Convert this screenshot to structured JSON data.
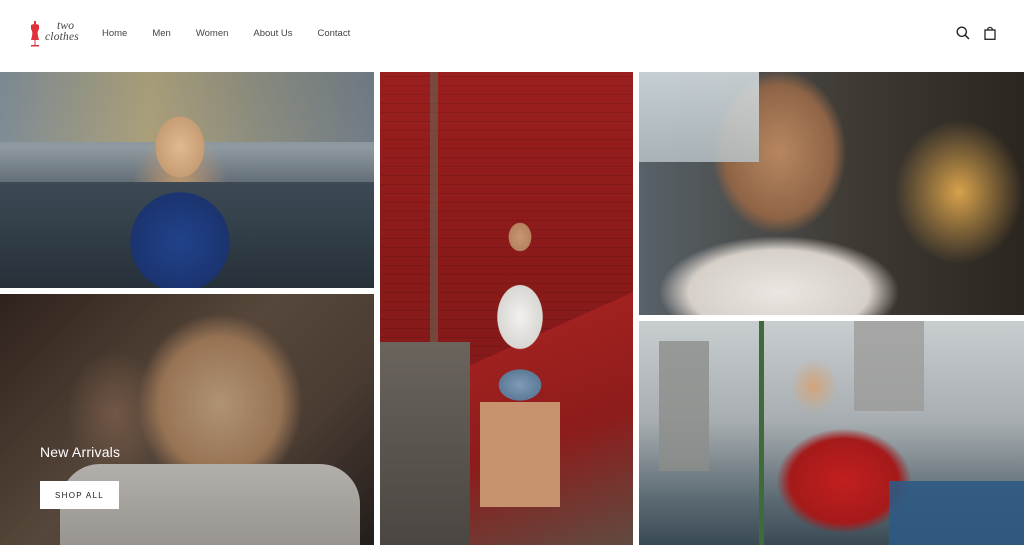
{
  "brand": {
    "logo_text_line1": "two",
    "logo_text_line2": "clothes",
    "accent_color": "#e0323a"
  },
  "nav": {
    "items": [
      {
        "label": "Home"
      },
      {
        "label": "Men"
      },
      {
        "label": "Women"
      },
      {
        "label": "About Us"
      },
      {
        "label": "Contact"
      }
    ]
  },
  "header_icons": {
    "search": "search-icon",
    "cart": "shopping-bag-icon"
  },
  "hero": {
    "caption": "New Arrivals",
    "button_label": "SHOP ALL"
  }
}
